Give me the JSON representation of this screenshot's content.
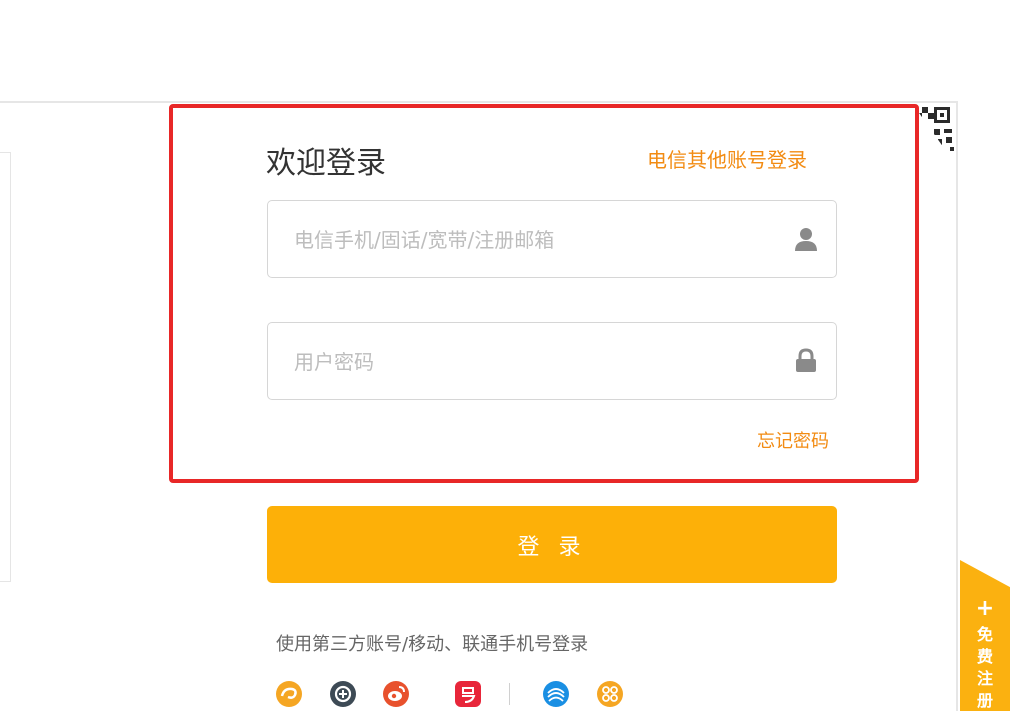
{
  "title": "欢迎登录",
  "other_login_label": "电信其他账号登录",
  "account_input": {
    "placeholder": "电信手机/固话/宽带/注册邮箱",
    "value": ""
  },
  "password_input": {
    "placeholder": "用户密码",
    "value": ""
  },
  "forgot_password_label": "忘记密码",
  "login_button_label": "登 录",
  "third_party_text": "使用第三方账号/移动、联通手机号登录",
  "social_icons": [
    {
      "name": "tianyi-icon",
      "color": "#f5a623"
    },
    {
      "name": "alipay-icon",
      "color": "#3d4a55"
    },
    {
      "name": "weibo-icon",
      "color": "#e8512d"
    },
    {
      "name": "yi-icon",
      "color": "#e8263a"
    },
    {
      "name": "china-mobile-icon",
      "color": "#1a8fe3"
    },
    {
      "name": "china-unicom-icon",
      "color": "#f5a623"
    }
  ],
  "register_tab": {
    "plus": "+",
    "label": "免费注册"
  },
  "colors": {
    "accent_orange": "#f28b12",
    "button_yellow": "#fdb008",
    "highlight_red": "#e82727"
  }
}
